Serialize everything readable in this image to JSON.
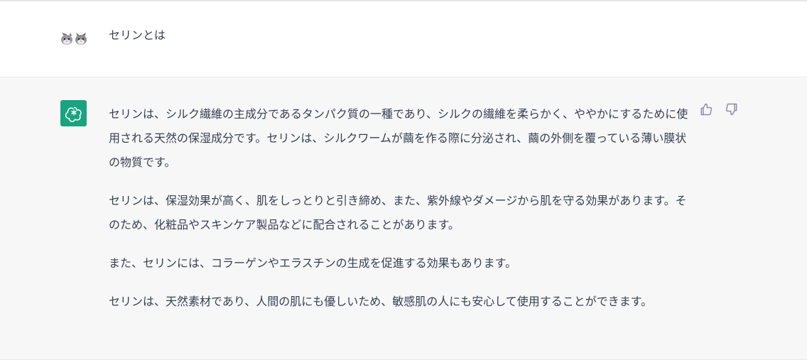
{
  "colors": {
    "assistant_avatar_bg": "#19a37f",
    "assistant_bg": "#f7f7f8",
    "text": "#374151"
  },
  "icons": {
    "user_avatar": "cat-avatar-icon",
    "assistant_avatar": "openai-logo-icon",
    "thumbs_up": "thumbs-up-icon",
    "thumbs_down": "thumbs-down-icon"
  },
  "user_message": {
    "text": "セリンとは"
  },
  "assistant_message": {
    "paragraphs": [
      "セリンは、シルク繊維の主成分であるタンパク質の一種であり、シルクの繊維を柔らかく、ややかにするために使用される天然の保湿成分です。セリンは、シルクワームが繭を作る際に分泌され、繭の外側を覆っている薄い膜状の物質です。",
      "セリンは、保湿効果が高く、肌をしっとりと引き締め、また、紫外線やダメージから肌を守る効果があります。そのため、化粧品やスキンケア製品などに配合されることがあります。",
      "また、セリンには、コラーゲンやエラスチンの生成を促進する効果もあります。",
      "セリンは、天然素材であり、人間の肌にも優しいため、敏感肌の人にも安心して使用することができます。"
    ]
  }
}
